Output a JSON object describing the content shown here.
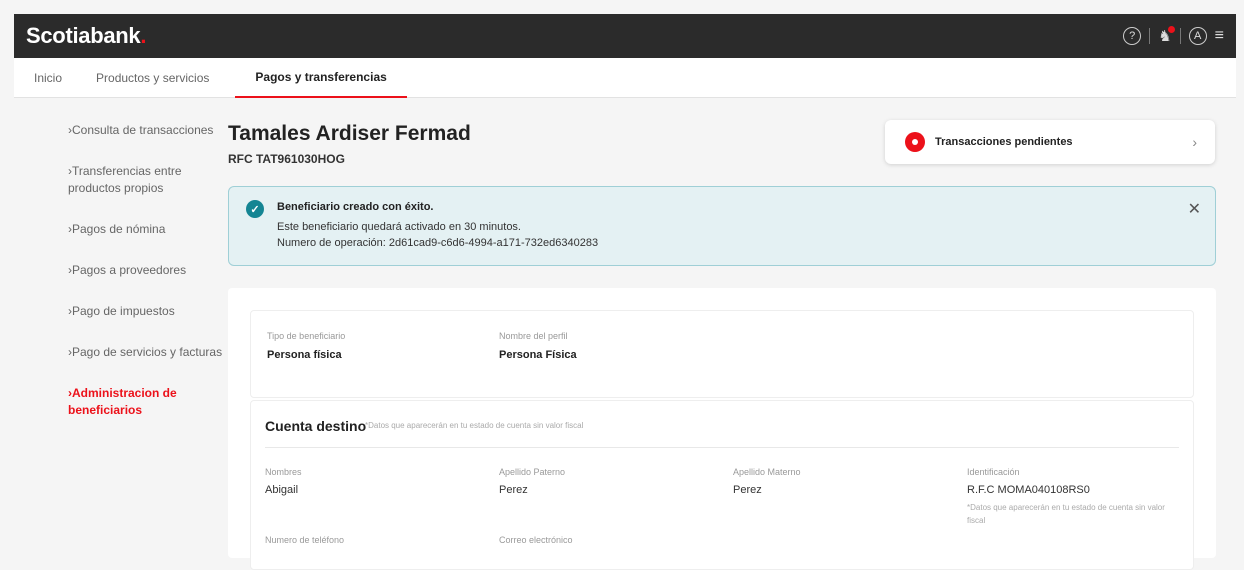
{
  "header": {
    "logo": "Scotiabank",
    "logo_dot": ".",
    "avatar_letter": "A"
  },
  "nav": [
    {
      "label": "Inicio"
    },
    {
      "label": "Productos y servicios"
    },
    {
      "label": "Pagos y transferencias"
    }
  ],
  "sidebar": [
    {
      "label": "›Consulta de transacciones"
    },
    {
      "label": "›Transferencias entre productos propios"
    },
    {
      "label": "›Pagos de nómina"
    },
    {
      "label": "›Pagos a proveedores"
    },
    {
      "label": "›Pago de impuestos"
    },
    {
      "label": "›Pago de servicios y facturas"
    },
    {
      "label": "›Administracion de beneficiarios"
    }
  ],
  "page": {
    "title": "Tamales Ardiser Fermad",
    "rfc": "RFC TAT961030HOG"
  },
  "pending": {
    "label": "Transacciones pendientes"
  },
  "alert": {
    "title": "Beneficiario creado con éxito.",
    "line1": "Este beneficiario quedará activado en 30 minutos.",
    "line2": "Numero de operación: 2d61cad9-c6d6-4994-a171-732ed6340283"
  },
  "beneficiary": {
    "type_label": "Tipo de beneficiario",
    "type_value": "Persona física",
    "profile_label": "Nombre del perfil",
    "profile_value": "Persona Física"
  },
  "account": {
    "heading": "Cuenta destino",
    "heading_note": "*Datos que aparecerán en tu estado de cuenta sin valor fiscal",
    "fields": [
      {
        "label": "Nombres",
        "value": "Abigail"
      },
      {
        "label": "Apellido Paterno",
        "value": "Perez"
      },
      {
        "label": "Apellido Materno",
        "value": "Perez"
      },
      {
        "label": "Identificación",
        "value": "R.F.C MOMA040108RS0"
      }
    ],
    "id_note": "*Datos que aparecerán en tu estado de cuenta sin valor fiscal",
    "phone_label": "Numero de teléfono",
    "email_label": "Correo electrónico"
  }
}
